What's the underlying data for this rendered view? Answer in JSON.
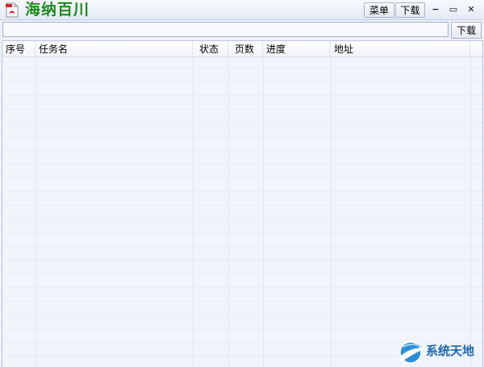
{
  "app": {
    "title": "海纳百川"
  },
  "toolbar": {
    "menu_label": "菜单",
    "download_label": "下载"
  },
  "window_controls": {
    "minimize": "−",
    "maximize": "▭",
    "close": "✕"
  },
  "url_bar": {
    "value": "",
    "placeholder": "",
    "download_label": "下载"
  },
  "list": {
    "columns": [
      {
        "label": "序号"
      },
      {
        "label": "任务名"
      },
      {
        "label": "状态"
      },
      {
        "label": "页数"
      },
      {
        "label": "进度"
      },
      {
        "label": "地址"
      }
    ],
    "rows": []
  },
  "watermark": {
    "text": "系统天地"
  },
  "colors": {
    "title_green": "#1f8a1f",
    "background": "#eef2fb",
    "watermark_blue": "#1b66b0"
  }
}
